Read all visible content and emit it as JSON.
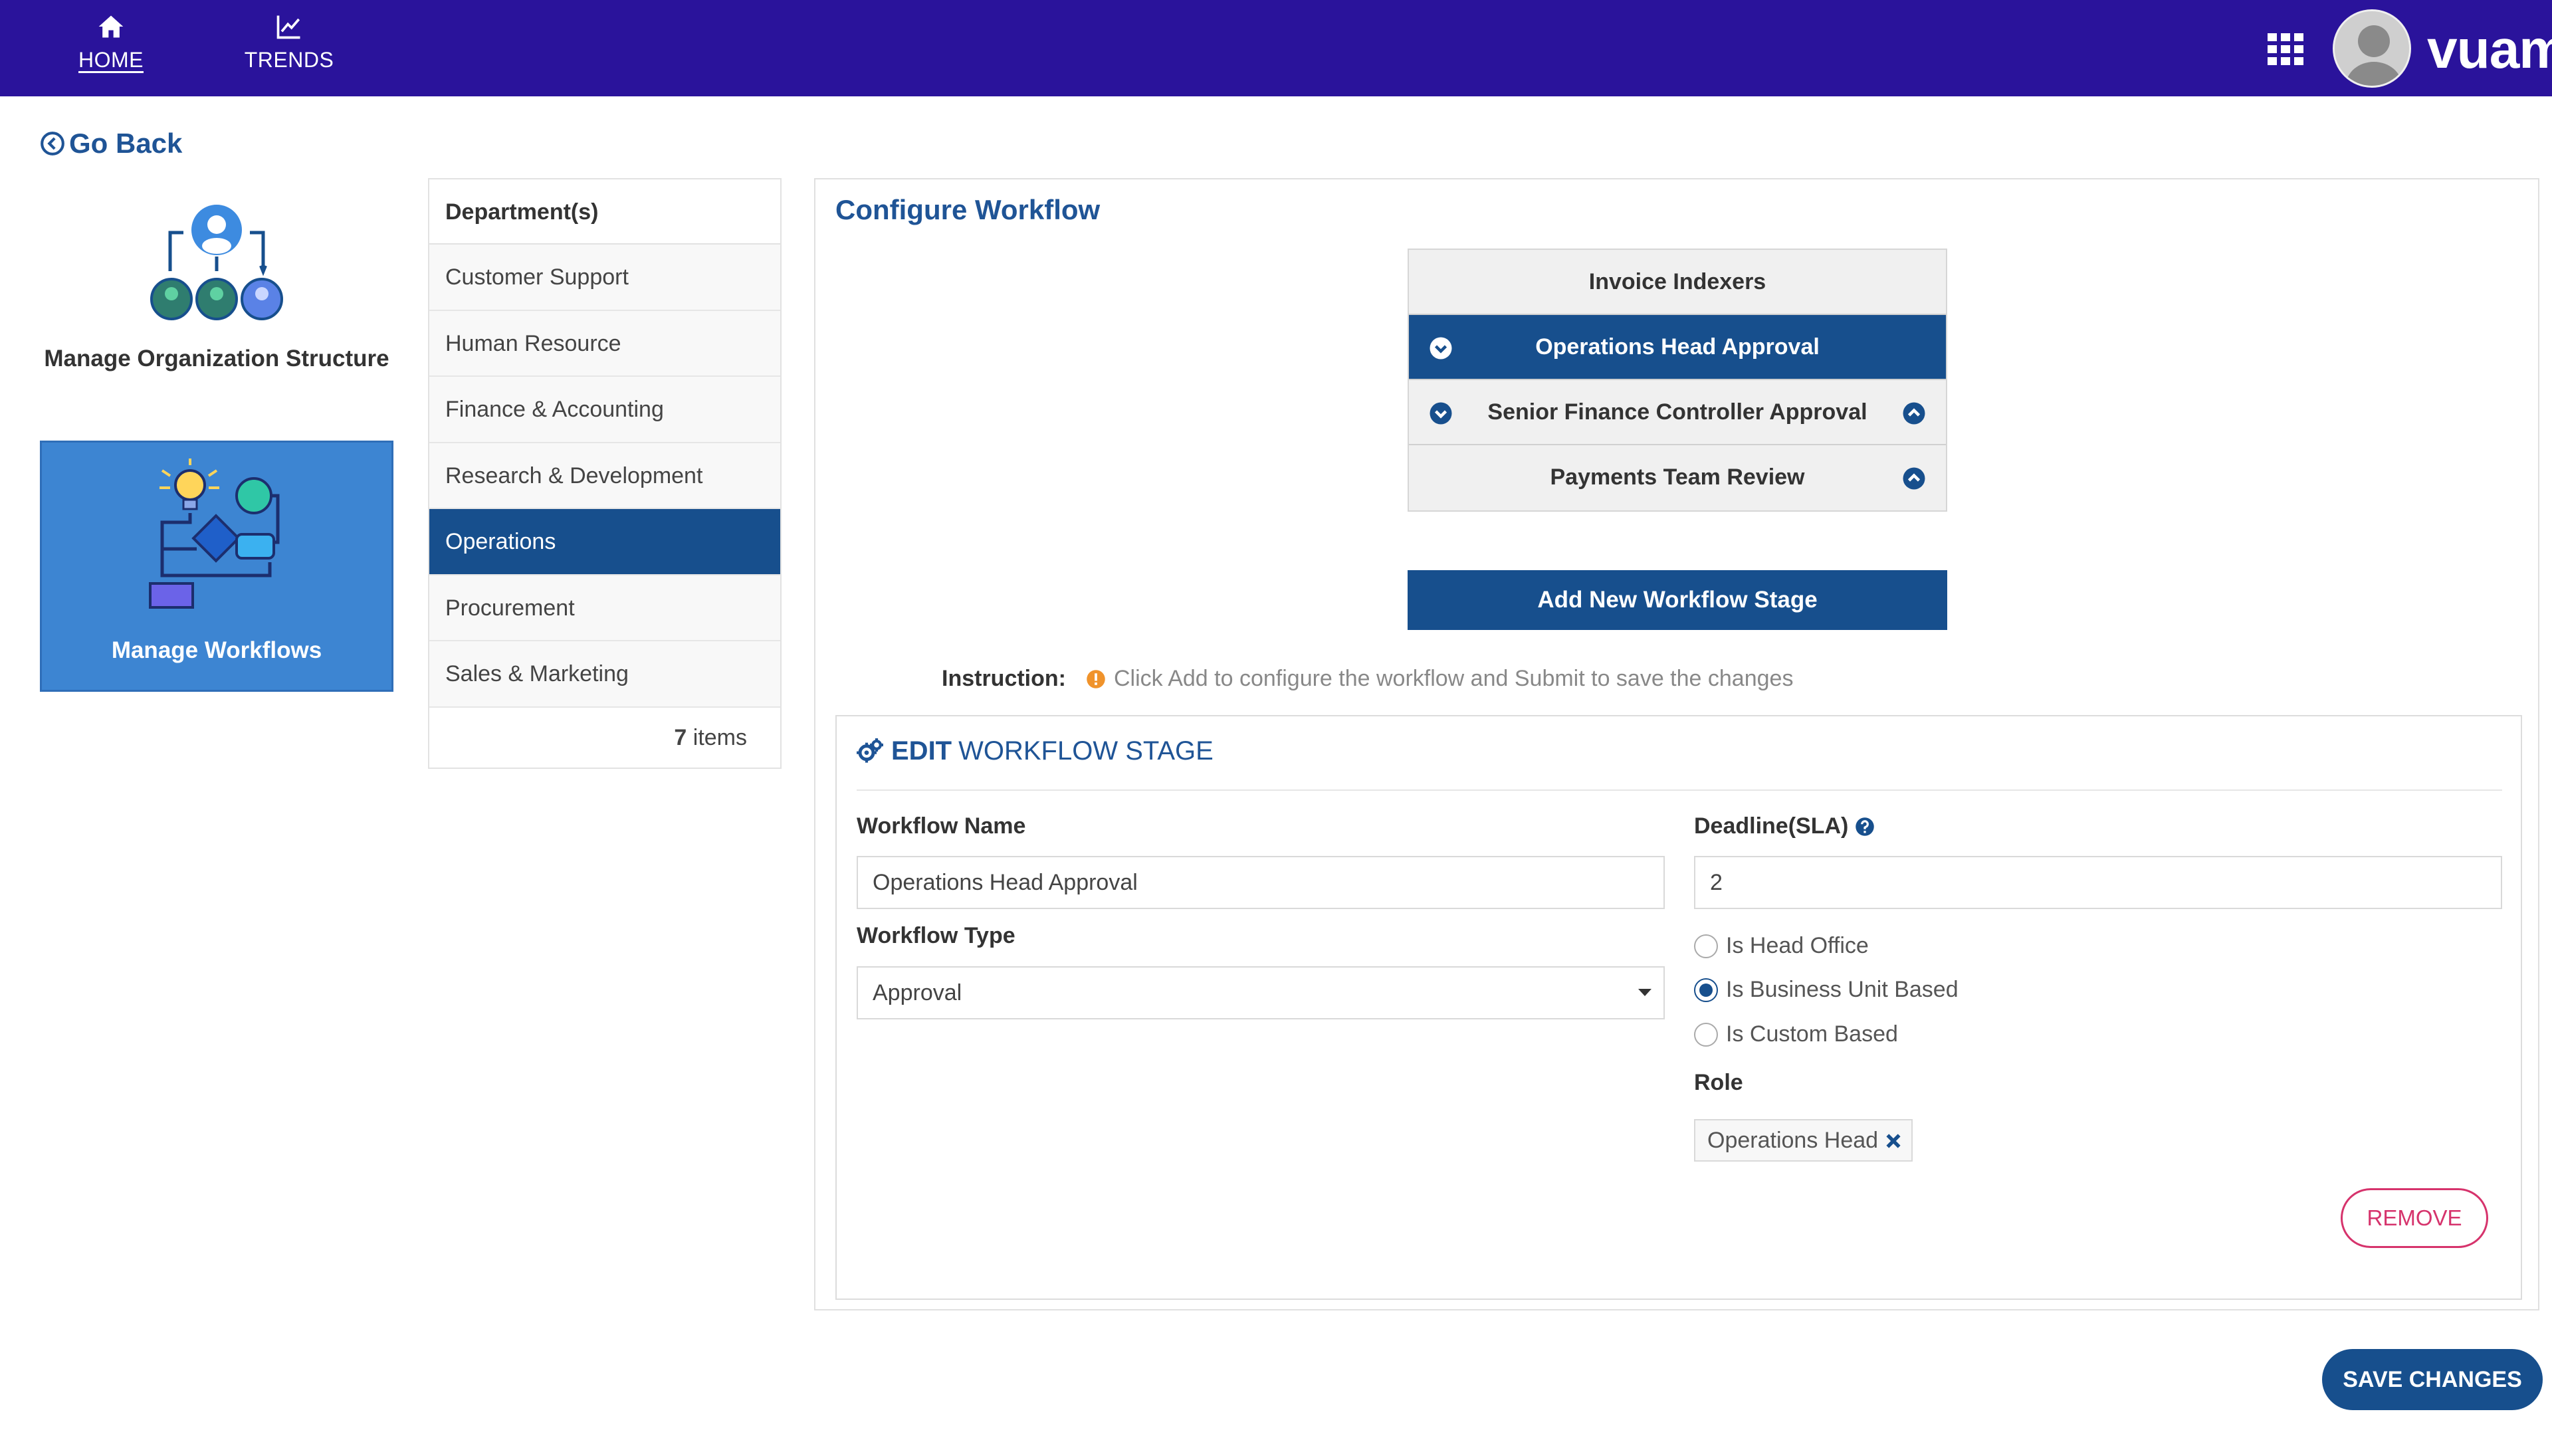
{
  "topbar": {
    "nav": [
      {
        "label": "HOME",
        "icon": "home-icon"
      },
      {
        "label": "TRENDS",
        "icon": "trends-icon"
      }
    ],
    "brand": "vuam",
    "colors": {
      "background": "#2a139b"
    }
  },
  "go_back": "Go Back",
  "tiles": {
    "org": "Manage Organization Structure",
    "workflows": "Manage Workflows"
  },
  "departments": {
    "header": "Department(s)",
    "items": [
      "Customer Support",
      "Human Resource",
      "Finance & Accounting",
      "Research & Development",
      "Operations",
      "Procurement",
      "Sales & Marketing"
    ],
    "selected": "Operations",
    "count": "7",
    "count_label": "items"
  },
  "configure": {
    "title": "Configure Workflow",
    "stages": [
      "Invoice Indexers",
      "Operations Head Approval",
      "Senior Finance Controller Approval",
      "Payments Team Review"
    ],
    "active_stage": "Operations Head Approval",
    "add_button": "Add New Workflow Stage",
    "instruction_label": "Instruction:",
    "instruction_text": "Click Add to configure the workflow and Submit to save the changes"
  },
  "edit_stage": {
    "heading_bold": "EDIT",
    "heading_rest": "WORKFLOW STAGE",
    "workflow_name_label": "Workflow Name",
    "workflow_name_value": "Operations Head Approval",
    "workflow_type_label": "Workflow Type",
    "workflow_type_value": "Approval",
    "deadline_label": "Deadline(SLA)",
    "deadline_value": "2",
    "radios": [
      {
        "label": "Is Head Office",
        "checked": false
      },
      {
        "label": "Is Business Unit Based",
        "checked": true
      },
      {
        "label": "Is Custom Based",
        "checked": false
      }
    ],
    "role_label": "Role",
    "role_chip": "Operations Head",
    "remove_button": "REMOVE"
  },
  "save_button": "SAVE CHANGES",
  "colors": {
    "primary": "#174f8d",
    "accent_link": "#1f5496",
    "danger": "#d6336c",
    "tile": "#3d85d2"
  }
}
